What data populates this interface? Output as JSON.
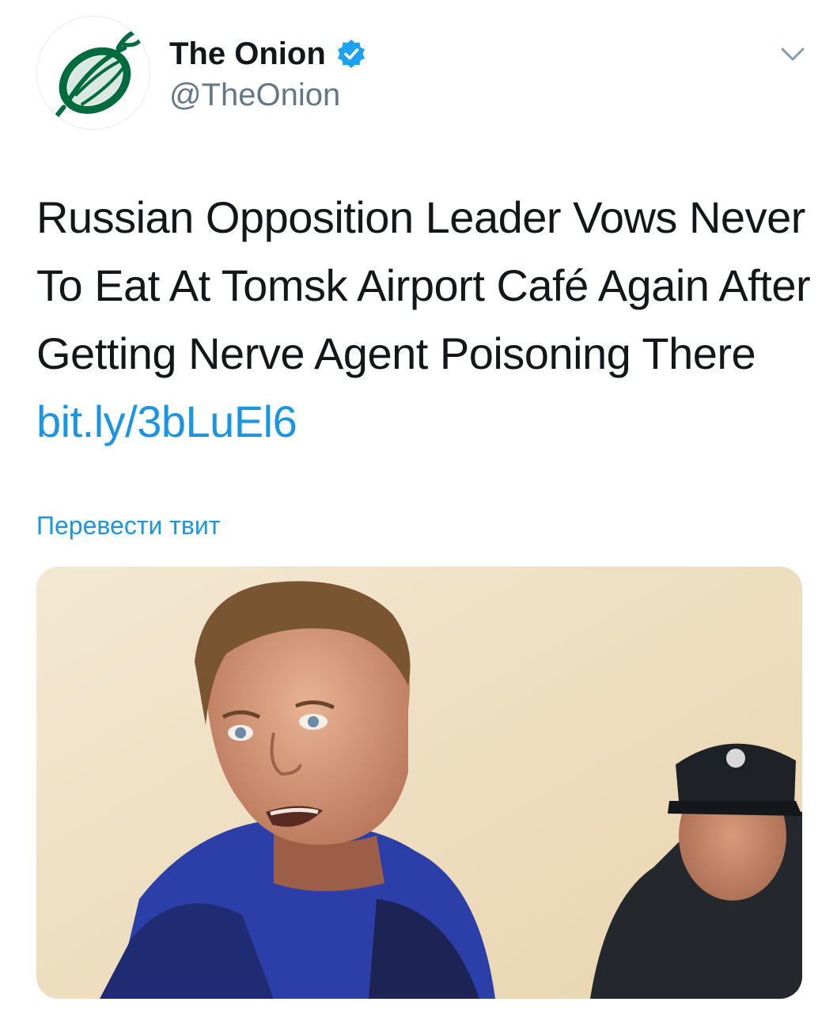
{
  "account": {
    "display_name": "The Onion",
    "handle": "@TheOnion",
    "verified": true,
    "avatar_icon": "onion-logo-icon",
    "brand_color": "#006b3f"
  },
  "tweet": {
    "text_main": "Russian Opposition Leader Vows Never To Eat At Tomsk Airport Café Again After Getting Nerve Agent Poisoning There",
    "link_text": "bit.ly/3bLuEl6",
    "translate_label": "Перевести твит"
  },
  "media": {
    "type": "photo"
  },
  "colors": {
    "link": "#1b95e0",
    "text": "#14171a",
    "secondary": "#657786",
    "verified": "#1da1f2"
  }
}
